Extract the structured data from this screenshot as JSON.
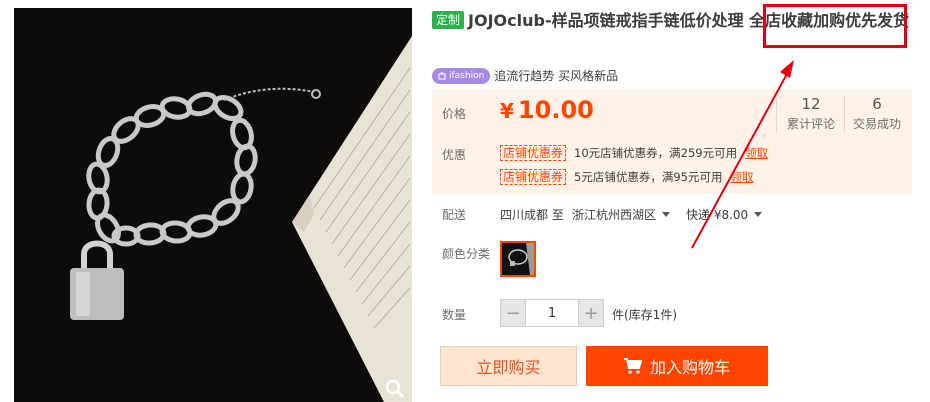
{
  "product": {
    "tag": "定制",
    "title": "JOJOclub-样品项链戒指手链低价处理 全店收藏加购优先发货",
    "badge": "ifashion",
    "slogan": "追流行趋势 买风格新品"
  },
  "price": {
    "label": "价格",
    "currency": "¥",
    "value": "10.00",
    "stats": [
      {
        "count": "12",
        "label": "累计评论"
      },
      {
        "count": "6",
        "label": "交易成功"
      }
    ]
  },
  "promo": {
    "label": "优惠",
    "coupons": [
      {
        "tag": "店铺优惠券",
        "text": "10元店铺优惠券，满259元可用",
        "action": "领取"
      },
      {
        "tag": "店铺优惠券",
        "text": "5元店铺优惠券，满95元可用",
        "action": "领取"
      }
    ]
  },
  "delivery": {
    "label": "配送",
    "from": "四川成都 至",
    "to": "浙江杭州西湖区",
    "shipping": "快递 ¥8.00"
  },
  "sku": {
    "label": "颜色分类"
  },
  "quantity": {
    "label": "数量",
    "value": "1",
    "minus": "−",
    "plus": "+",
    "unit": "件(库存1件)"
  },
  "actions": {
    "buy_now": "立即购买",
    "add_cart": "加入购物车"
  },
  "colors": {
    "accent": "#ff4400",
    "annotation": "#e4000f",
    "panel_bg": "#fff2e8"
  }
}
